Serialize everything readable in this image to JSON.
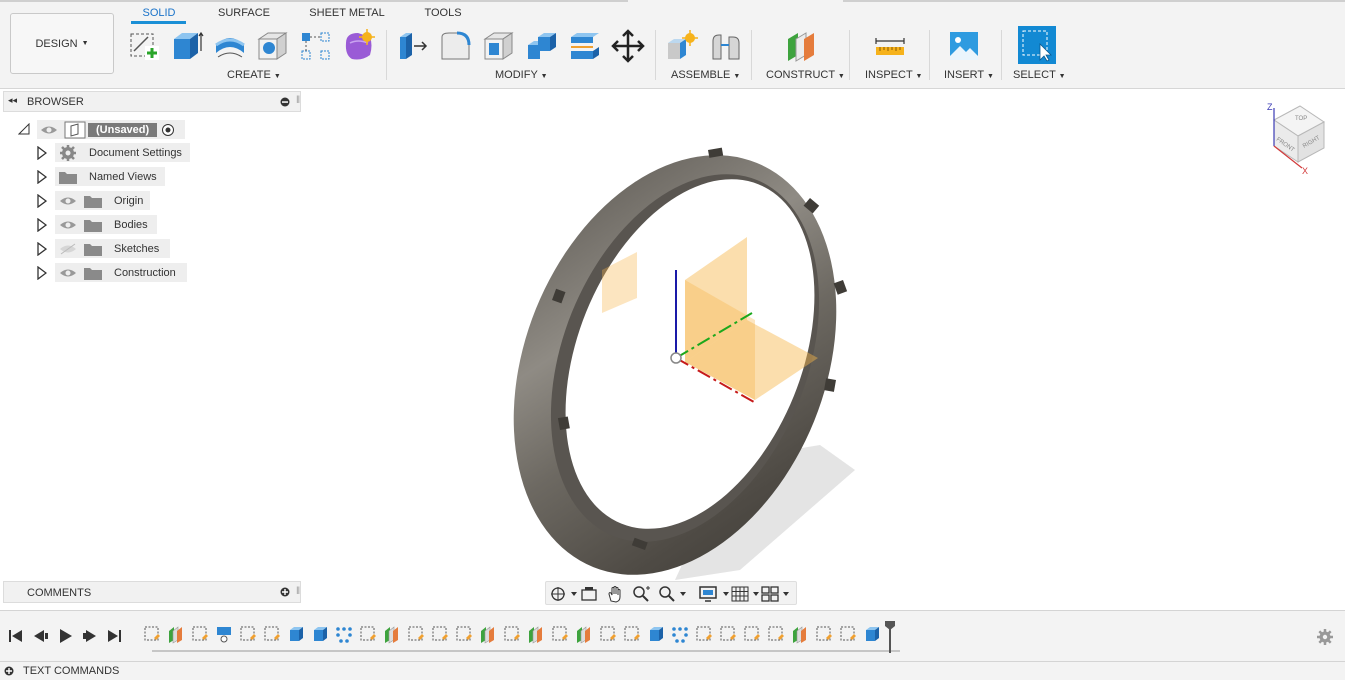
{
  "workspace": {
    "label": "DESIGN"
  },
  "tabs": [
    {
      "label": "SOLID",
      "active": true
    },
    {
      "label": "SURFACE",
      "active": false
    },
    {
      "label": "SHEET METAL",
      "active": false
    },
    {
      "label": "TOOLS",
      "active": false
    }
  ],
  "groups": {
    "create": "CREATE",
    "modify": "MODIFY",
    "assemble": "ASSEMBLE",
    "construct": "CONSTRUCT",
    "inspect": "INSPECT",
    "insert": "INSERT",
    "select": "SELECT"
  },
  "browser": {
    "title": "BROWSER",
    "root": "(Unsaved)",
    "items": [
      {
        "label": "Document Settings",
        "icon": "gear-icon"
      },
      {
        "label": "Named Views",
        "icon": "folder-icon"
      },
      {
        "label": "Origin",
        "icon": "folder-icon"
      },
      {
        "label": "Bodies",
        "icon": "folder-icon"
      },
      {
        "label": "Sketches",
        "icon": "folder-icon"
      },
      {
        "label": "Construction",
        "icon": "folder-icon"
      }
    ]
  },
  "viewcube": {
    "top": "TOP",
    "front": "FRONT",
    "right": "RIGHT",
    "z": "Z",
    "x": "X"
  },
  "comments": {
    "title": "COMMENTS"
  },
  "text_commands": {
    "title": "TEXT COMMANDS"
  },
  "timeline": {
    "features": [
      "sketch",
      "plane",
      "sketch",
      "revolve",
      "sketch",
      "sketch",
      "extrude",
      "extrude",
      "pattern",
      "sketch",
      "plane",
      "sketch",
      "sketch",
      "sketch",
      "plane",
      "sketch",
      "plane",
      "sketch",
      "plane",
      "sketch",
      "sketch",
      "extrude",
      "pattern",
      "sketch",
      "sketch",
      "sketch",
      "sketch",
      "plane",
      "sketch",
      "sketch",
      "extrude"
    ]
  },
  "colors": {
    "accent": "#1a8fd6",
    "select_bg": "#1289d3",
    "plane": "#f7b54a",
    "ring": "#6b675f"
  }
}
